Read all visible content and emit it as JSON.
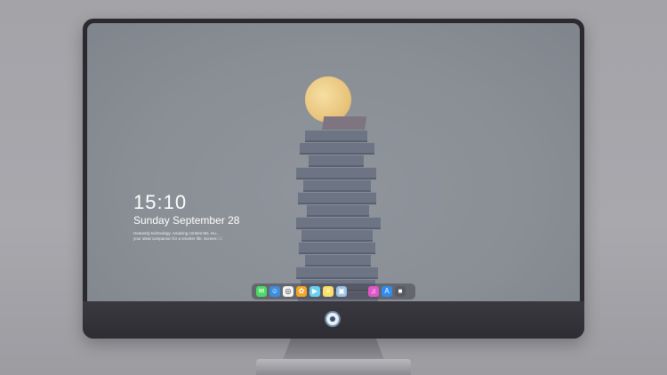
{
  "lock_screen": {
    "time": "15:10",
    "date": "Sunday September 28",
    "fine_print_line1": "Heavenly technology. Amazing content Ms. Hu...",
    "fine_print_line2": "your ideal companion for a smarter life. Screen\u0000\u0000"
  },
  "dock": {
    "apps": [
      {
        "name": "messages-icon",
        "color": "#4cd964",
        "glyph": "✉"
      },
      {
        "name": "finder-icon",
        "color": "#3b8de0",
        "glyph": "☺"
      },
      {
        "name": "safari-icon",
        "color": "#f2f2f2",
        "glyph": "◎"
      },
      {
        "name": "photos-icon",
        "color": "#f5a623",
        "glyph": "✿"
      },
      {
        "name": "imovie-icon",
        "color": "#6ad0f2",
        "glyph": "▶"
      },
      {
        "name": "notes-icon",
        "color": "#f8e06a",
        "glyph": "≡"
      },
      {
        "name": "preview-icon",
        "color": "#9bc3e6",
        "glyph": "▣"
      },
      {
        "name": "itunes-icon",
        "color": "#e356c9",
        "glyph": "♫"
      },
      {
        "name": "app-store-icon",
        "color": "#2f8cf0",
        "glyph": "A"
      },
      {
        "name": "folder-icon",
        "color": "#5a5a62",
        "glyph": "■"
      }
    ]
  },
  "colors": {
    "background": "#a3a3a8",
    "bezel": "#2b2a30",
    "screen": "#8a8f96"
  }
}
